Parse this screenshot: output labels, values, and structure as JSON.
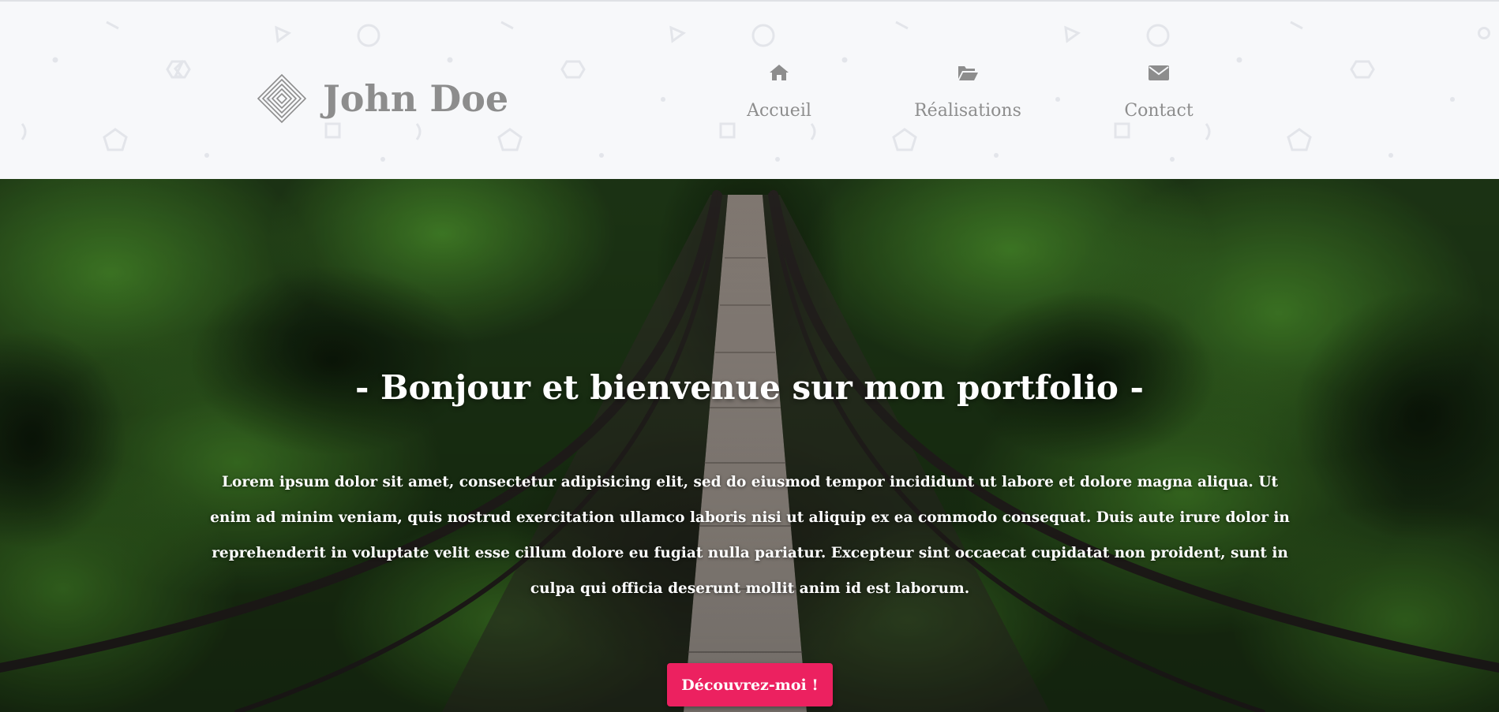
{
  "header": {
    "brand_name": "John Doe",
    "logo_icon": "concentric-diamond-logo",
    "nav": [
      {
        "label": "Accueil",
        "icon": "home-icon"
      },
      {
        "label": "Réalisations",
        "icon": "folder-open-icon"
      },
      {
        "label": "Contact",
        "icon": "envelope-icon"
      }
    ]
  },
  "hero": {
    "background": "suspension-bridge-forest-photo",
    "title": "- Bonjour et bienvenue sur mon portfolio -",
    "text": "Lorem ipsum dolor sit amet, consectetur adipisicing elit, sed do eiusmod tempor incididunt ut labore et dolore magna aliqua. Ut enim ad minim veniam, quis nostrud exercitation ullamco laboris nisi ut aliquip ex ea commodo consequat. Duis aute irure dolor in reprehenderit in voluptate velit esse cillum dolore eu fugiat nulla pariatur. Excepteur sint occaecat cupidatat non proident, sunt in culpa qui officia deserunt mollit anim id est laborum.",
    "cta_label": "Découvrez-moi !"
  },
  "colors": {
    "header_bg": "#f7f8fa",
    "text_gray": "#8d8d8d",
    "cta": "#ec2160",
    "forest_dark": "#1c3315"
  }
}
